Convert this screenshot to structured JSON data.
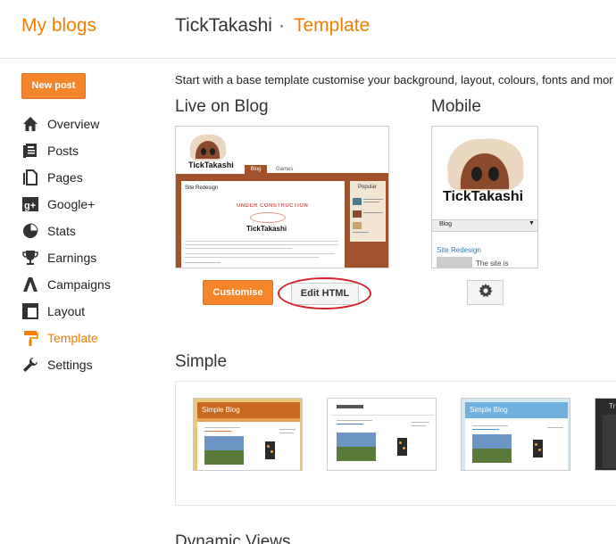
{
  "header": {
    "app_title": "My blogs",
    "blog_name": "TickTakashi",
    "separator": "·",
    "page_title": "Template"
  },
  "sidebar": {
    "new_post_label": "New post",
    "items": [
      {
        "label": "Overview",
        "icon": "home-icon"
      },
      {
        "label": "Posts",
        "icon": "posts-icon"
      },
      {
        "label": "Pages",
        "icon": "pages-icon"
      },
      {
        "label": "Google+",
        "icon": "google-plus-icon"
      },
      {
        "label": "Stats",
        "icon": "pie-chart-icon"
      },
      {
        "label": "Earnings",
        "icon": "trophy-icon"
      },
      {
        "label": "Campaigns",
        "icon": "campaigns-icon"
      },
      {
        "label": "Layout",
        "icon": "layout-icon"
      },
      {
        "label": "Template",
        "icon": "paint-roller-icon",
        "active": true
      },
      {
        "label": "Settings",
        "icon": "wrench-icon"
      }
    ]
  },
  "main": {
    "intro": "Start with a base template customise your background, layout, colours, fonts and mor",
    "live_heading": "Live on Blog",
    "mobile_heading": "Mobile",
    "customise_label": "Customise",
    "edit_html_label": "Edit HTML",
    "simple_heading": "Simple",
    "dynamic_heading": "Dynamic Views"
  },
  "live_preview": {
    "blog_title": "TickTakashi",
    "tabs": [
      "Blog",
      "Games"
    ],
    "post_title": "Site Redesign",
    "sidebar_title": "Popular",
    "under_construction": "UNDER CONSTRUCTION"
  },
  "mobile_preview": {
    "blog_title": "TickTakashi",
    "nav_label": "Blog",
    "nav_arrow": "▼",
    "post_title": "Site Redesign",
    "post_snippet": "The site is"
  },
  "simple_templates": [
    {
      "title": "Simple Blog",
      "theme": "orange"
    },
    {
      "title": "",
      "theme": "white"
    },
    {
      "title": "Simple Blog",
      "theme": "blue"
    },
    {
      "title": "Tr",
      "theme": "dark"
    }
  ],
  "colors": {
    "accent": "#f57d00",
    "button_orange": "#f5852a",
    "highlight_ring": "#d8202a",
    "blog_brown": "#a0522d"
  }
}
